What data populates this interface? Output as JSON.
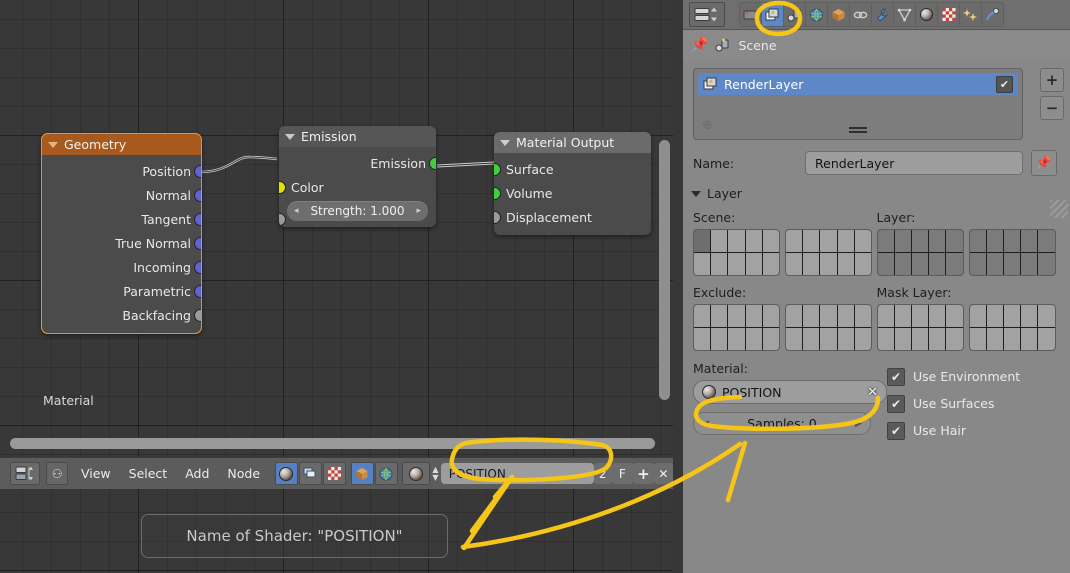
{
  "accent": {
    "orange_node": "#e8912e",
    "blue_select": "#5d87c6",
    "ink_yellow": "#f5c518",
    "socket_vector": "#6363ce",
    "socket_float": "#9a9a9a",
    "socket_shader": "#3ecf3e",
    "socket_color": "#e2e200"
  },
  "node_editor": {
    "watermark_label": "Material",
    "nodes": [
      {
        "title": "Geometry",
        "header_style": "orange",
        "selected": true,
        "outputs": [
          {
            "label": "Position",
            "type": "vector"
          },
          {
            "label": "Normal",
            "type": "vector"
          },
          {
            "label": "Tangent",
            "type": "vector"
          },
          {
            "label": "True Normal",
            "type": "vector"
          },
          {
            "label": "Incoming",
            "type": "vector"
          },
          {
            "label": "Parametric",
            "type": "vector"
          },
          {
            "label": "Backfacing",
            "type": "float"
          }
        ]
      },
      {
        "title": "Emission",
        "header_style": "grey",
        "selected": false,
        "outputs": [
          {
            "label": "Emission",
            "type": "shader"
          }
        ],
        "inputs": [
          {
            "label": "Color",
            "type": "color"
          }
        ],
        "slider": {
          "label": "Strength: 1.000",
          "left_arrow": "◂",
          "right_arrow": "▸"
        }
      },
      {
        "title": "Material Output",
        "header_style": "grey2",
        "selected": false,
        "inputs": [
          {
            "label": "Surface",
            "type": "shader"
          },
          {
            "label": "Volume",
            "type": "shader"
          },
          {
            "label": "Displacement",
            "type": "float"
          }
        ]
      }
    ],
    "header_bar": {
      "editor_type_icon": "node-editor-icon",
      "browse_icon": "browse-scene-icon",
      "menus": [
        "View",
        "Select",
        "Add",
        "Node"
      ],
      "shader_type_icons": [
        "material-ball-icon",
        "world-icon",
        "texture-checker-icon"
      ],
      "context_icons": [
        "object-cube-icon",
        "world-globe-icon"
      ],
      "datablock_icon": "material-ball-icon",
      "material_name": "POSITION",
      "users_count": "2",
      "fake_user_label": "F",
      "new_label": "+",
      "unlink_label": "✕"
    }
  },
  "properties": {
    "tabs": [
      {
        "name": "render-tab",
        "active": false
      },
      {
        "name": "render-layers-tab",
        "active": true
      },
      {
        "name": "scene-tab",
        "active": false
      },
      {
        "name": "world-tab",
        "active": false
      },
      {
        "name": "object-tab",
        "active": false
      },
      {
        "name": "constraints-tab",
        "active": false
      },
      {
        "name": "modifiers-tab",
        "active": false
      },
      {
        "name": "data-tab",
        "active": false
      },
      {
        "name": "material-tab",
        "active": false
      },
      {
        "name": "texture-tab",
        "active": false
      },
      {
        "name": "particles-tab",
        "active": false
      },
      {
        "name": "physics-tab",
        "active": false
      }
    ],
    "breadcrumb": {
      "pin_icon": "pin-icon",
      "scene_icon": "scene-icon",
      "label": "Scene"
    },
    "render_layers": {
      "items": [
        {
          "icon": "renderlayer-icon",
          "label": "RenderLayer",
          "enabled": true,
          "check_glyph": "✔"
        }
      ],
      "add_icon": "⊕",
      "grip": "=",
      "plus_label": "+",
      "minus_label": "−",
      "name_label": "Name:",
      "name_value": "RenderLayer",
      "pin_icon": "pin-icon"
    },
    "layer_panel": {
      "title": "Layer",
      "scene_label": "Scene:",
      "layer_label": "Layer:",
      "exclude_label": "Exclude:",
      "mask_layer_label": "Mask Layer:",
      "scene_selected_index": 0,
      "material_label": "Material:",
      "material_value": "POSITION",
      "material_icon": "material-ball-icon",
      "material_clear_icon": "✕",
      "samples_label": "Samples: 0",
      "checkboxes": [
        {
          "label": "Use Environment",
          "checked": true
        },
        {
          "label": "Use Surfaces",
          "checked": true
        },
        {
          "label": "Use Hair",
          "checked": true
        }
      ],
      "check_glyph": "✔"
    }
  },
  "annotation": {
    "callout_text": "Name of Shader: \"POSITION\"",
    "circled_items": [
      "render-layers-tab",
      "node-editor-material-name",
      "properties-material-field"
    ]
  }
}
